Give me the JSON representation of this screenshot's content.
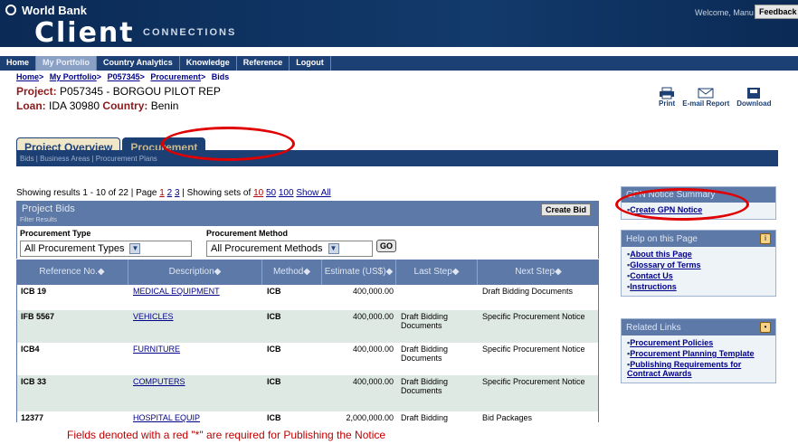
{
  "banner": {
    "org": "World Bank",
    "brand": "Client",
    "brand_sub": "CONNECTIONS",
    "welcome": "Welcome, Manu Lama",
    "feedback": "Feedback"
  },
  "nav": [
    "Home",
    "My Portfolio",
    "Country Analytics",
    "Knowledge",
    "Reference",
    "Logout"
  ],
  "breadcrumb": [
    "Home",
    "My Portfolio",
    "P057345",
    "Procurement",
    "Bids"
  ],
  "project": {
    "label": "Project:",
    "id": "P057345",
    "name": " - BORGOU PILOT REP",
    "loan_label": "Loan:",
    "loan": "IDA 30980",
    "country_label": "Country:",
    "country": "Benin"
  },
  "tools": {
    "print": "Print",
    "email": "E-mail Report",
    "download": "Download"
  },
  "tabs": {
    "overview": "Project Overview",
    "procurement": "Procurement",
    "sub": "Bids | Business Areas | Procurement Plans"
  },
  "results": {
    "showing": "Showing results 1 - 10 of",
    "total": "22",
    "page_label": "| Page",
    "pages": [
      "1",
      "2",
      "3"
    ],
    "sets_label": "| Showing sets of",
    "sets": [
      "10",
      "50",
      "100"
    ],
    "show_all": "Show All"
  },
  "panel": {
    "title": "Project Bids",
    "create_bid": "Create Bid",
    "filter_label": "Filter Results",
    "type_label": "Procurement Type",
    "type_value": "All Procurement Types",
    "method_label": "Procurement Method",
    "method_value": "All Procurement Methods",
    "go": "GO"
  },
  "columns": [
    "Reference No.",
    "Description",
    "Method",
    "Estimate (US$)",
    "Last Step",
    "Next Step"
  ],
  "rows": [
    {
      "ref": "ICB 19",
      "desc": "MEDICAL EQUIPMENT",
      "method": "ICB",
      "estimate": "400,000.00",
      "last": "",
      "next": "Draft Bidding Documents"
    },
    {
      "ref": "IFB 5567",
      "desc": "VEHICLES",
      "method": "ICB",
      "estimate": "400,000.00",
      "last": "Draft Bidding Documents",
      "next": "Specific Procurement Notice"
    },
    {
      "ref": "ICB4",
      "desc": "FURNITURE",
      "method": "ICB",
      "estimate": "400,000.00",
      "last": "Draft Bidding Documents",
      "next": "Specific Procurement Notice"
    },
    {
      "ref": "ICB 33",
      "desc": "COMPUTERS",
      "method": "ICB",
      "estimate": "400,000.00",
      "last": "Draft Bidding Documents",
      "next": "Specific Procurement Notice"
    },
    {
      "ref": "12377",
      "desc": "HOSPITAL EQUIP",
      "method": "ICB",
      "estimate": "2,000,000.00",
      "last": "Draft Bidding",
      "next": "Bid Packages"
    }
  ],
  "gpn": {
    "title": "GPN Notice Summary",
    "link": "Create GPN Notice"
  },
  "help": {
    "title": "Help on this Page",
    "links": [
      "About this Page",
      "Glossary of Terms",
      "Contact Us",
      "Instructions"
    ]
  },
  "related": {
    "title": "Related Links",
    "links": [
      "Procurement Policies",
      "Procurement Planning Template",
      "Publishing Requirements for Contract Awards"
    ]
  },
  "footer_note": "Fields denoted with a red \"*\" are required for Publishing the Notice"
}
